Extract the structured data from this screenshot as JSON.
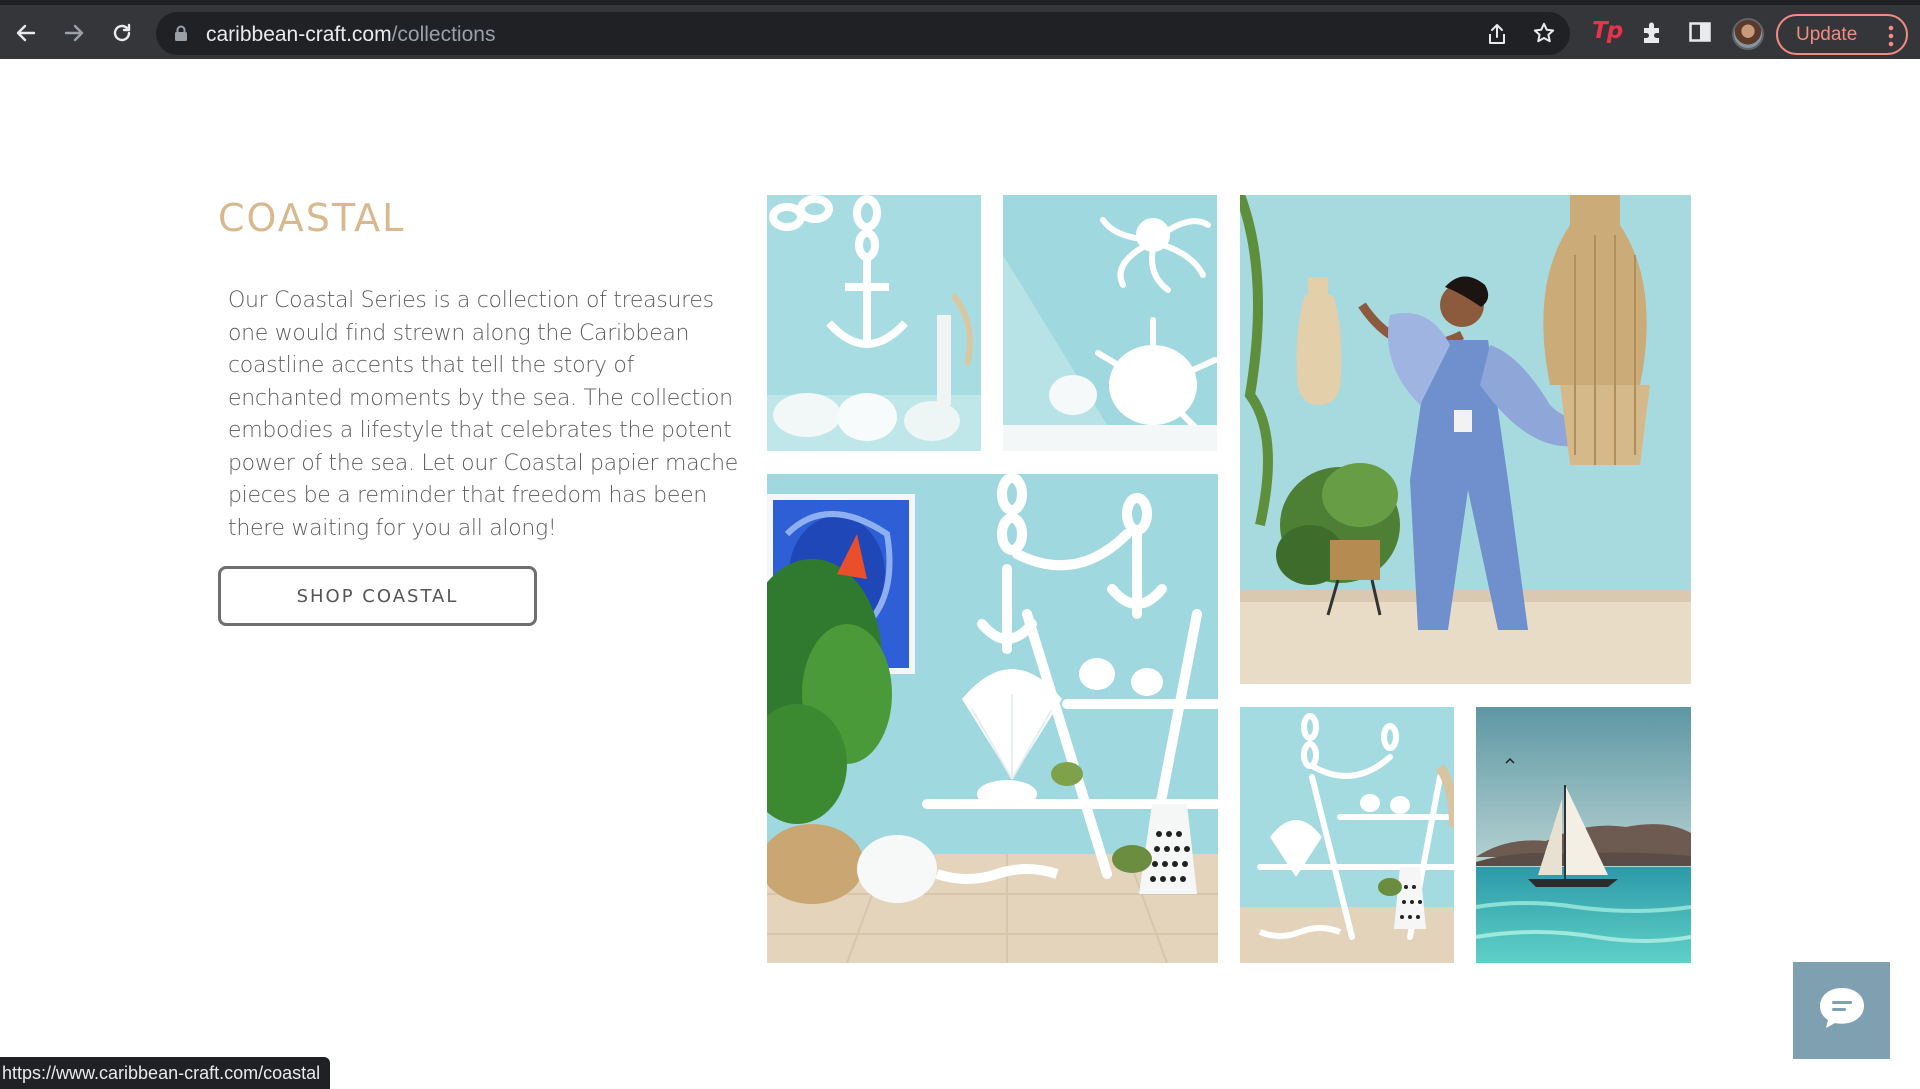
{
  "browser": {
    "url_domain": "caribbean-craft.com",
    "url_path": "/collections",
    "update_label": "Update",
    "extension_logo": "Tp",
    "icons": [
      "back-icon",
      "forward-icon",
      "reload-icon",
      "lock-icon",
      "share-icon",
      "star-icon",
      "puzzle-icon",
      "sidebar-icon",
      "kebab-icon"
    ]
  },
  "collection": {
    "title": "COASTAL",
    "description": "Our Coastal Series is a collection of treasures one would find strewn along the Caribbean coastline accents that tell the story of enchanted moments by the sea. The collection embodies a lifestyle that celebrates the potent power of the sea. Let our Coastal papier mache pieces be a reminder that freedom has been there waiting for you all along!",
    "button_label": "SHOP COASTAL"
  },
  "gallery": {
    "photos": [
      "anchor-and-chain-photo",
      "octopus-and-shells-photo",
      "woman-with-vase-photo",
      "coastal-shelf-display-photo",
      "shelf-display-small-photo",
      "sailboat-sea-photo"
    ]
  },
  "colors": {
    "accent_title": "#d8b98f",
    "aqua_wall": "#a9dde3",
    "chat_button": "#7fa0b1",
    "update_pill": "#f28b82"
  },
  "status_bar": {
    "link": "https://www.caribbean-craft.com/coastal"
  }
}
